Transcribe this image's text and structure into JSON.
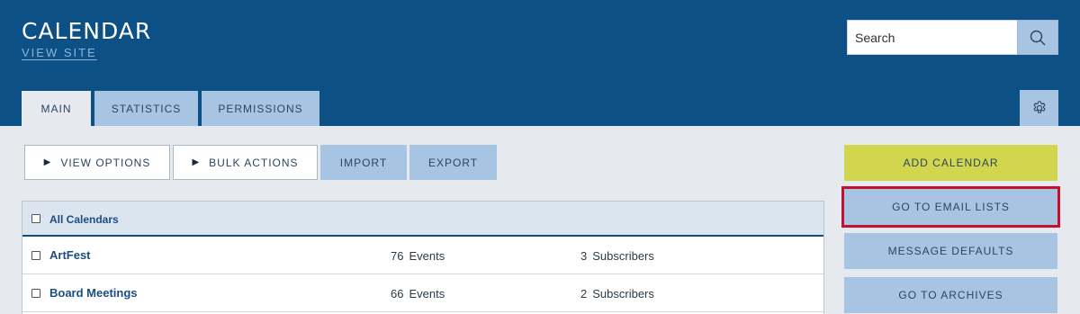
{
  "header": {
    "title": "CALENDAR",
    "view_site": "VIEW SITE",
    "search_placeholder": "Search"
  },
  "tabs": [
    {
      "label": "MAIN",
      "active": true
    },
    {
      "label": "STATISTICS",
      "active": false
    },
    {
      "label": "PERMISSIONS",
      "active": false
    }
  ],
  "toolbar": {
    "view_options": "VIEW OPTIONS",
    "bulk_actions": "BULK ACTIONS",
    "import": "IMPORT",
    "export": "EXPORT"
  },
  "table": {
    "header_label": "All Calendars",
    "rows": [
      {
        "name": "ArtFest",
        "events_count": "76",
        "events_label": "Events",
        "subscribers_count": "3",
        "subscribers_label": "Subscribers"
      },
      {
        "name": "Board Meetings",
        "events_count": "66",
        "events_label": "Events",
        "subscribers_count": "2",
        "subscribers_label": "Subscribers"
      }
    ]
  },
  "sidebar": {
    "add_calendar": "ADD CALENDAR",
    "go_to_email_lists": "GO TO EMAIL LISTS",
    "message_defaults": "MESSAGE DEFAULTS",
    "go_to_archives": "GO TO ARCHIVES"
  },
  "icons": {
    "search": "search-icon",
    "settings": "gear-icon",
    "expand": "triangle-right-icon"
  },
  "colors": {
    "header_bg": "#0c5085",
    "tab_bg": "#a7c4e2",
    "page_bg": "#e6eaef",
    "add_button": "#d2d54e",
    "highlight_outline": "#c8102e"
  }
}
